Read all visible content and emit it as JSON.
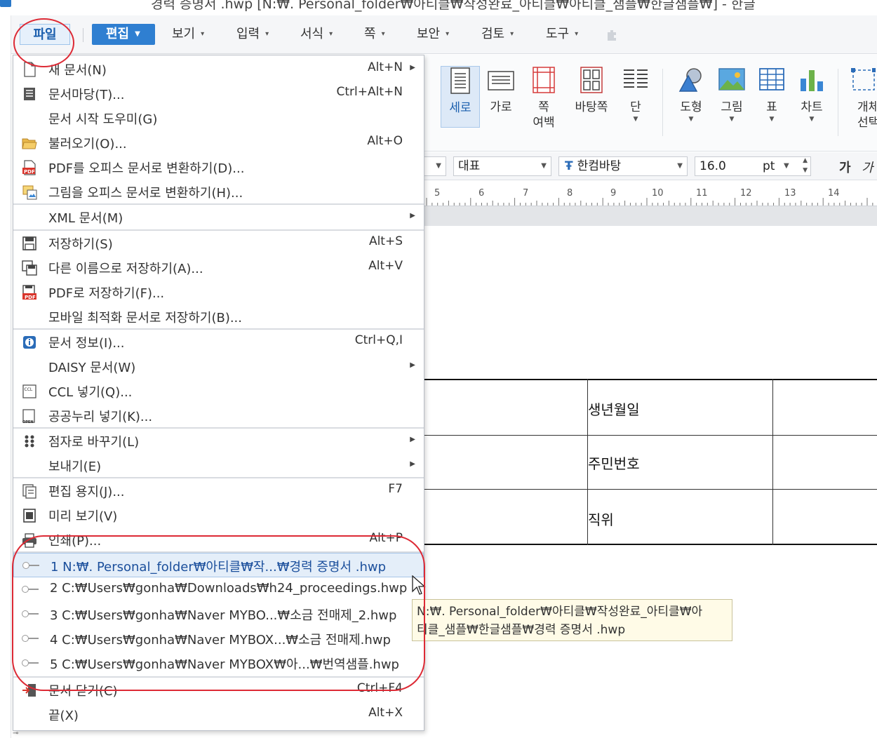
{
  "window": {
    "title": "경력 증명서 .hwp [N:₩. Personal_folder₩아티클₩작성완료_아티클₩아티클_샘플₩한글샘플₩] - 한글"
  },
  "menubar": {
    "items": [
      {
        "label": "파일"
      },
      {
        "label": "편집"
      },
      {
        "label": "보기"
      },
      {
        "label": "입력"
      },
      {
        "label": "서식"
      },
      {
        "label": "쪽"
      },
      {
        "label": "보안"
      },
      {
        "label": "검토"
      },
      {
        "label": "도구"
      }
    ]
  },
  "ribbon": {
    "buttons": [
      {
        "label": "세로",
        "icon": "portrait-page-icon"
      },
      {
        "label": "가로",
        "icon": "landscape-page-icon"
      },
      {
        "label": "쪽",
        "label2": "여백",
        "icon": "page-margin-icon"
      },
      {
        "label": "바탕쪽",
        "icon": "master-page-icon"
      },
      {
        "label": "단",
        "icon": "columns-icon"
      },
      {
        "label": "도형",
        "icon": "shape-icon"
      },
      {
        "label": "그림",
        "icon": "picture-icon"
      },
      {
        "label": "표",
        "icon": "table-icon"
      },
      {
        "label": "차트",
        "icon": "chart-icon"
      },
      {
        "label": "개체",
        "label2": "선택",
        "icon": "select-object-icon"
      }
    ]
  },
  "format_bar": {
    "style": "대표",
    "font": "한컴바탕",
    "font_icon": "Ŧ",
    "size": "16.0",
    "unit": "pt",
    "bold": "가",
    "italic": "가"
  },
  "ruler": {
    "numbers": [
      "5",
      "6",
      "7",
      "8",
      "9",
      "10",
      "11",
      "12",
      "13",
      "14"
    ]
  },
  "document": {
    "rows": [
      "생년월일",
      "주민번호",
      "직위"
    ]
  },
  "file_menu": {
    "items": [
      {
        "label": "새 문서(N)",
        "shortcut": "Alt+N",
        "submenu": true,
        "icon": "new-document-icon"
      },
      {
        "label": "문서마당(T)...",
        "shortcut": "Ctrl+Alt+N",
        "icon": "template-icon"
      },
      {
        "label": "문서 시작 도우미(G)",
        "shortcut": ""
      },
      {
        "label": "불러오기(O)...",
        "shortcut": "Alt+O",
        "icon": "open-folder-icon"
      },
      {
        "label": "PDF를 오피스 문서로 변환하기(D)...",
        "shortcut": "",
        "icon": "pdf-convert-icon"
      },
      {
        "label": "그림을 오피스 문서로 변환하기(H)...",
        "shortcut": "",
        "icon": "image-convert-icon"
      },
      {
        "label": "XML 문서(M)",
        "shortcut": "",
        "submenu": true
      },
      {
        "label": "저장하기(S)",
        "shortcut": "Alt+S",
        "icon": "save-icon"
      },
      {
        "label": "다른 이름으로 저장하기(A)...",
        "shortcut": "Alt+V",
        "icon": "save-as-icon"
      },
      {
        "label": "PDF로 저장하기(F)...",
        "shortcut": "",
        "icon": "save-pdf-icon"
      },
      {
        "label": "모바일 최적화 문서로 저장하기(B)...",
        "shortcut": ""
      },
      {
        "label": "문서 정보(I)...",
        "shortcut": "Ctrl+Q,I",
        "icon": "info-icon"
      },
      {
        "label": "DAISY 문서(W)",
        "shortcut": "",
        "submenu": true
      },
      {
        "label": "CCL 넣기(Q)...",
        "shortcut": "",
        "icon": "ccl-icon"
      },
      {
        "label": "공공누리 넣기(K)...",
        "shortcut": "",
        "icon": "open-license-icon"
      },
      {
        "label": "점자로 바꾸기(L)",
        "shortcut": "",
        "submenu": true,
        "icon": "braille-icon"
      },
      {
        "label": "보내기(E)",
        "shortcut": "",
        "submenu": true
      },
      {
        "label": "편집 용지(J)...",
        "shortcut": "F7",
        "icon": "page-setup-icon"
      },
      {
        "label": "미리 보기(V)",
        "shortcut": "",
        "icon": "preview-icon"
      },
      {
        "label": "인쇄(P)...",
        "shortcut": "Alt+P",
        "icon": "print-icon"
      },
      {
        "label": "문서 닫기(C)",
        "shortcut": "Ctrl+F4",
        "icon": "close-document-icon"
      },
      {
        "label": "끝(X)",
        "shortcut": "Alt+X"
      }
    ],
    "recent": [
      "1 N:₩. Personal_folder₩아티클₩작...₩경력 증명서 .hwp",
      "2 C:₩Users₩gonha₩Downloads₩h24_proceedings.hwp",
      "3 C:₩Users₩gonha₩Naver MYBO...₩소금 전매제_2.hwp",
      "4 C:₩Users₩gonha₩Naver MYBOX...₩소금 전매제.hwp",
      "5 C:₩Users₩gonha₩Naver MYBOX₩아...₩번역샘플.hwp"
    ]
  },
  "tooltip": {
    "line1": "N:₩. Personal_folder₩아티클₩작성완료_아티클₩아",
    "line2": "티클_샘플₩한글샘플₩경력 증명서 .hwp"
  },
  "colors": {
    "accent": "#2f7fd1",
    "annotation": "#dd2a35",
    "tooltip_bg": "#fffbe7"
  }
}
